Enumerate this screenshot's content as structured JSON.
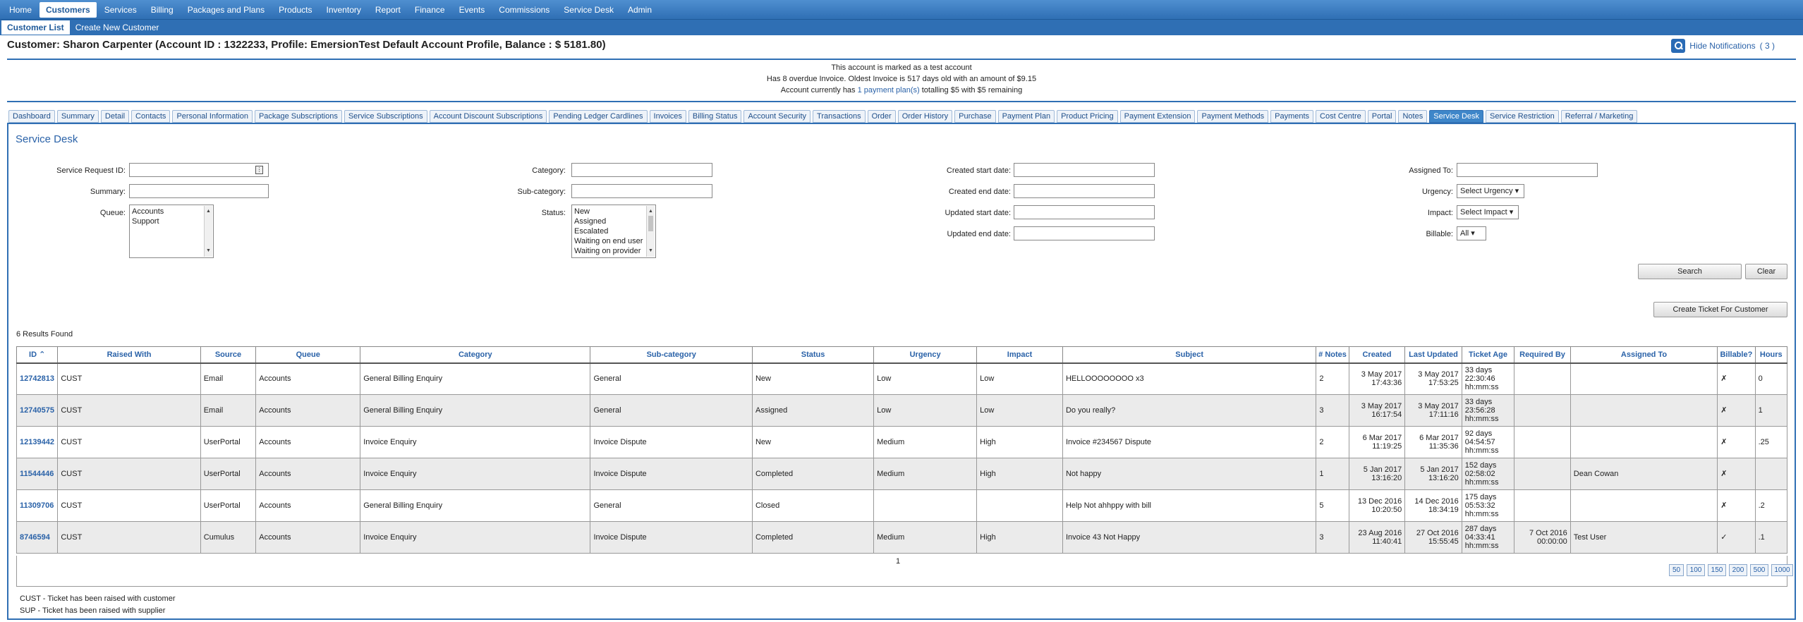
{
  "topnav": [
    "Home",
    "Customers",
    "Services",
    "Billing",
    "Packages and Plans",
    "Products",
    "Inventory",
    "Report",
    "Finance",
    "Events",
    "Commissions",
    "Service Desk",
    "Admin"
  ],
  "subnav": [
    "Customer List",
    "Create New Customer"
  ],
  "page_title": "Customer: Sharon Carpenter (Account ID : 1322233, Profile: EmersionTest Default Account Profile, Balance : $ 5181.80)",
  "notifications": {
    "label": "Hide Notifications",
    "count": "( 3 )"
  },
  "alerts": {
    "line1": "This account is marked as a test account",
    "line2": "Has 8 overdue Invoice. Oldest Invoice is 517 days old with an amount of $9.15",
    "line3_pre": "Account currently has ",
    "line3_link": "1 payment plan(s)",
    "line3_post": " totalling $5 with $5 remaining"
  },
  "tabs": [
    "Dashboard",
    "Summary",
    "Detail",
    "Contacts",
    "Personal Information",
    "Package Subscriptions",
    "Service Subscriptions",
    "Account Discount Subscriptions",
    "Pending Ledger Cardlines",
    "Invoices",
    "Billing Status",
    "Account Security",
    "Transactions",
    "Order",
    "Order History",
    "Purchase",
    "Payment Plan",
    "Product Pricing",
    "Payment Extension",
    "Payment Methods",
    "Payments",
    "Cost Centre",
    "Portal",
    "Notes",
    "Service Desk",
    "Service Restriction",
    "Referral / Marketing"
  ],
  "active_tab": "Service Desk",
  "panel_title": "Service Desk",
  "form": {
    "service_request_id": "Service Request ID:",
    "summary": "Summary:",
    "queue": "Queue:",
    "queue_options": [
      "Accounts",
      "Support"
    ],
    "category": "Category:",
    "sub_category": "Sub-category:",
    "status": "Status:",
    "status_options": [
      "New",
      "Assigned",
      "Escalated",
      "Waiting on end user",
      "Waiting on provider"
    ],
    "created_start": "Created start date:",
    "created_end": "Created end date:",
    "updated_start": "Updated start date:",
    "updated_end": "Updated end date:",
    "assigned_to": "Assigned To:",
    "urgency": "Urgency:",
    "urgency_value": "Select Urgency ▾",
    "impact": "Impact:",
    "impact_value": "Select Impact ▾",
    "billable": "Billable:",
    "billable_value": "All ▾",
    "search": "Search",
    "clear": "Clear",
    "create_ticket": "Create Ticket For Customer"
  },
  "results_found": "6 Results Found",
  "table": {
    "headers": [
      "ID",
      "Raised With",
      "Source",
      "Queue",
      "Category",
      "Sub-category",
      "Status",
      "Urgency",
      "Impact",
      "Subject",
      "# Notes",
      "Created",
      "Last Updated",
      "Ticket Age",
      "Required By",
      "Assigned To",
      "Billable?",
      "Hours"
    ],
    "rows": [
      [
        "12742813",
        "CUST",
        "Email",
        "Accounts",
        "General Billing Enquiry",
        "General",
        "New",
        "Low",
        "Low",
        "HELLOOOOOOOO x3",
        "2",
        "3 May 2017\n17:43:36",
        "3 May 2017\n17:53:25",
        "33 days\n22:30:46\nhh:mm:ss",
        "",
        "",
        "✗",
        "0"
      ],
      [
        "12740575",
        "CUST",
        "Email",
        "Accounts",
        "General Billing Enquiry",
        "General",
        "Assigned",
        "Low",
        "Low",
        "Do you really?",
        "3",
        "3 May 2017\n16:17:54",
        "3 May 2017\n17:11:16",
        "33 days\n23:56:28\nhh:mm:ss",
        "",
        "",
        "✗",
        "1"
      ],
      [
        "12139442",
        "CUST",
        "UserPortal",
        "Accounts",
        "Invoice Enquiry",
        "Invoice Dispute",
        "New",
        "Medium",
        "High",
        "Invoice #234567 Dispute",
        "2",
        "6 Mar 2017\n11:19:25",
        "6 Mar 2017\n11:35:36",
        "92 days\n04:54:57\nhh:mm:ss",
        "",
        "",
        "✗",
        ".25"
      ],
      [
        "11544446",
        "CUST",
        "UserPortal",
        "Accounts",
        "Invoice Enquiry",
        "Invoice Dispute",
        "Completed",
        "Medium",
        "High",
        "Not happy",
        "1",
        "5 Jan 2017\n13:16:20",
        "5 Jan 2017\n13:16:20",
        "152 days\n02:58:02\nhh:mm:ss",
        "",
        "Dean Cowan",
        "✗",
        ""
      ],
      [
        "11309706",
        "CUST",
        "UserPortal",
        "Accounts",
        "General Billing Enquiry",
        "General",
        "Closed",
        "",
        "",
        "Help Not ahhppy with bill",
        "5",
        "13 Dec 2016\n10:20:50",
        "14 Dec 2016\n18:34:19",
        "175 days\n05:53:32\nhh:mm:ss",
        "",
        "",
        "✗",
        ".2"
      ],
      [
        "8746594",
        "CUST",
        "Cumulus",
        "Accounts",
        "Invoice Enquiry",
        "Invoice Dispute",
        "Completed",
        "Medium",
        "High",
        "Invoice 43 Not Happy",
        "3",
        "23 Aug 2016\n11:40:41",
        "27 Oct 2016\n15:55:45",
        "287 days\n04:33:41\nhh:mm:ss",
        "7 Oct 2016\n00:00:00",
        "Test User",
        "✓",
        ".1"
      ]
    ]
  },
  "pager": {
    "page": "1",
    "sizes": [
      "50",
      "100",
      "150",
      "200",
      "500",
      "1000"
    ]
  },
  "legend": [
    "CUST - Ticket has been raised with customer",
    "SUP - Ticket has been raised with supplier"
  ]
}
